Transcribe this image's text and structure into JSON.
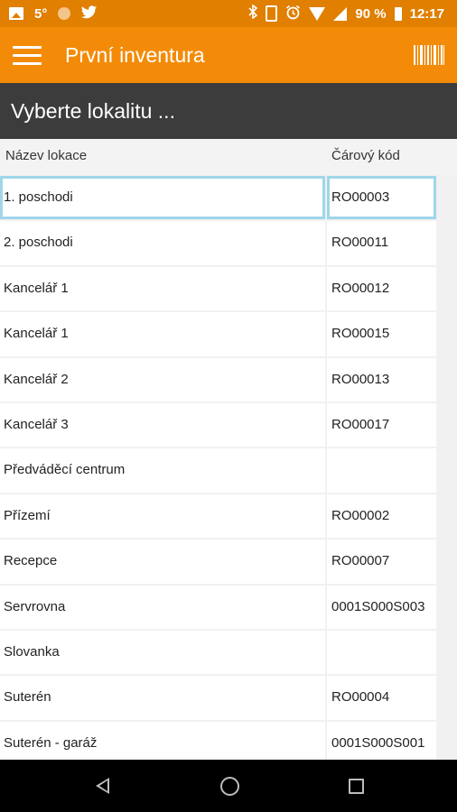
{
  "status_bar": {
    "temperature": "5°",
    "battery": "90 %",
    "time": "12:17",
    "icons": [
      "image-icon",
      "weather-icon",
      "twitter-icon",
      "bluetooth-icon",
      "vibrate-icon",
      "alarm-icon",
      "wifi-icon",
      "signal-icon",
      "battery-icon"
    ]
  },
  "app_bar": {
    "title": "První inventura",
    "menu_icon": "menu-icon",
    "action_icon": "barcode-icon",
    "color": "#f38b08"
  },
  "subheader": {
    "title": "Vyberte lokalitu ..."
  },
  "table": {
    "columns": [
      "Název lokace",
      "Čárový kód"
    ],
    "rows": [
      {
        "name": "1. poschodi",
        "code": "RO00003",
        "selected": true
      },
      {
        "name": "2. poschodi",
        "code": "RO00011"
      },
      {
        "name": "Kancelář 1",
        "code": "RO00012"
      },
      {
        "name": "Kancelář 1",
        "code": "RO00015"
      },
      {
        "name": "Kancelář 2",
        "code": "RO00013"
      },
      {
        "name": "Kancelář 3",
        "code": "RO00017"
      },
      {
        "name": "Předváděcí centrum",
        "code": ""
      },
      {
        "name": "Přízemí",
        "code": "RO00002"
      },
      {
        "name": "Recepce",
        "code": "RO00007"
      },
      {
        "name": "Servrovna",
        "code": "0001S000S003"
      },
      {
        "name": "Slovanka",
        "code": ""
      },
      {
        "name": "Suterén",
        "code": "RO00004"
      },
      {
        "name": "Suterén - garáž",
        "code": "0001S000S001"
      }
    ]
  },
  "nav_bar": {
    "buttons": [
      "back-icon",
      "home-icon",
      "recents-icon"
    ]
  }
}
